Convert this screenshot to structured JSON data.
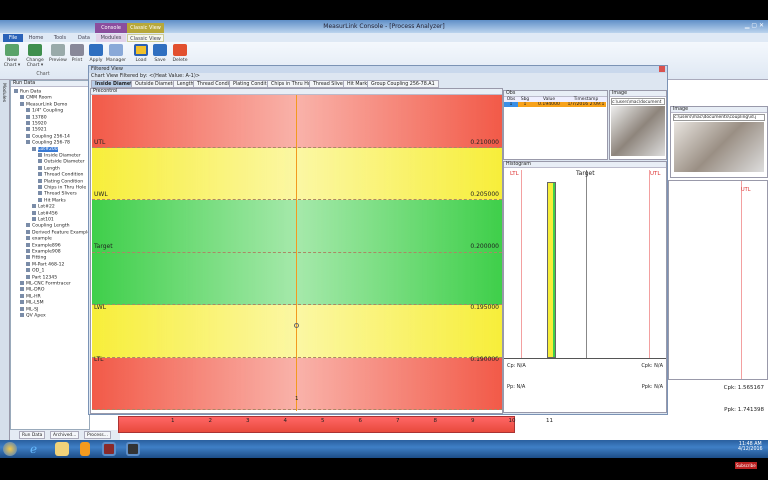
{
  "window": {
    "title": "MeasurLink Console - [Process Analyzer]"
  },
  "ribbon": {
    "context_tabs": [
      {
        "label": "Console",
        "color": "#8b4e9e"
      },
      {
        "label": "Classic View",
        "color": "#b7a83a"
      }
    ],
    "tabs": [
      "File",
      "Home",
      "Tools",
      "Data",
      "Modules",
      "Classic View"
    ],
    "active_tab": "Classic View",
    "buttons": [
      {
        "label": "New Chart ▾",
        "icon": "new-chart-icon"
      },
      {
        "label": "Change Chart ▾",
        "icon": "change-chart-icon"
      },
      {
        "label": "Preview",
        "icon": "preview-icon"
      },
      {
        "label": "Print",
        "icon": "print-icon"
      },
      {
        "label": "Apply",
        "icon": "apply-icon"
      },
      {
        "label": "Manager",
        "icon": "manager-icon"
      },
      {
        "label": "Load",
        "icon": "load-icon"
      },
      {
        "label": "Save",
        "icon": "save-icon"
      },
      {
        "label": "Delete",
        "icon": "delete-icon"
      }
    ],
    "group_label": "Chart"
  },
  "sidebar": {
    "strip_label": "Modules",
    "header": "Run Data",
    "tree": [
      {
        "label": "Run Data",
        "level": 0
      },
      {
        "label": "CMM Room",
        "level": 1
      },
      {
        "label": "MeasurLink Demo",
        "level": 1
      },
      {
        "label": "1/4\" Coupling",
        "level": 2
      },
      {
        "label": "13780",
        "level": 2
      },
      {
        "label": "15920",
        "level": 2
      },
      {
        "label": "15921",
        "level": 2
      },
      {
        "label": "Coupling 256-14",
        "level": 2
      },
      {
        "label": "Coupling 256-78",
        "level": 2
      },
      {
        "label": "Lot#200",
        "level": 3,
        "selected": true
      },
      {
        "label": "Inside Diameter",
        "level": 4
      },
      {
        "label": "Outside Diameter",
        "level": 4
      },
      {
        "label": "Length",
        "level": 4
      },
      {
        "label": "Thread Condition",
        "level": 4
      },
      {
        "label": "Plating Condition",
        "level": 4
      },
      {
        "label": "Chips in Thru Hole",
        "level": 4
      },
      {
        "label": "Thread Slivers",
        "level": 4
      },
      {
        "label": "Hit Marks",
        "level": 4
      },
      {
        "label": "Lot#22",
        "level": 3
      },
      {
        "label": "Lot#456",
        "level": 3
      },
      {
        "label": "Lot101",
        "level": 3
      },
      {
        "label": "Coupling Length",
        "level": 2
      },
      {
        "label": "Derived Feature Example",
        "level": 2
      },
      {
        "label": "example",
        "level": 2
      },
      {
        "label": "Example896",
        "level": 2
      },
      {
        "label": "Example908",
        "level": 2
      },
      {
        "label": "Fitting",
        "level": 2
      },
      {
        "label": "M-Part 468-12",
        "level": 2
      },
      {
        "label": "OD_1",
        "level": 2
      },
      {
        "label": "Part 12345",
        "level": 2
      },
      {
        "label": "ML-CNC Formtracer",
        "level": 1
      },
      {
        "label": "ML-DRO",
        "level": 1
      },
      {
        "label": "ML-HR",
        "level": 1
      },
      {
        "label": "ML-LSM",
        "level": 1
      },
      {
        "label": "ML-SJ",
        "level": 1
      },
      {
        "label": "QV Apex",
        "level": 1
      }
    ],
    "bottom_tabs": [
      "Run Data",
      "Archived...",
      "Process..."
    ]
  },
  "filtered_view": {
    "title": "Filtered View",
    "filter_text": "Chart View Filtered by: <(Heat Value: A-1)>",
    "tabs": [
      "Inside Diameter",
      "Outside Diameter",
      "Length",
      "Thread Condition",
      "Plating Condition",
      "Chips in Thru Hole",
      "Thread Slivers",
      "Hit Marks",
      "Group Coupling 256-78.A1"
    ],
    "active_tab": "Inside Diameter",
    "precontrol": {
      "title": "Precontrol",
      "limits": [
        {
          "label": "UTL",
          "value": "0.210000"
        },
        {
          "label": "UWL",
          "value": "0.205000"
        },
        {
          "label": "Target",
          "value": "0.200000"
        },
        {
          "label": "LWL",
          "value": "0.195000"
        },
        {
          "label": "LTL",
          "value": "0.190000"
        }
      ],
      "zone_colors": {
        "red": "#f25a48",
        "yellow": "#f7ee3a",
        "green": "#3fcf4a"
      },
      "points": [
        {
          "obs": 1,
          "value": 0.194
        }
      ],
      "x_label": "1"
    },
    "obs": {
      "title": "Obs",
      "columns": [
        "Obs",
        "Sbg",
        "Value",
        "Timestamp"
      ],
      "rows": [
        [
          "1",
          "1",
          "0.194000",
          "1/7/2016 2:09:1"
        ]
      ]
    },
    "image": {
      "title": "Image",
      "path": "c:\\users\\mac\\document"
    },
    "histogram": {
      "title": "Histogram",
      "ltl": "LTL",
      "utl": "UTL",
      "target": "Target",
      "cp": "Cp: N/A",
      "cpk": "Cpk: N/A",
      "pp": "Pp: N/A",
      "ppk": "Ppk: N/A"
    }
  },
  "background_window": {
    "image_title": "Image",
    "image_path": "c:\\users\\mac\\documents\\coupling\\id.j",
    "utl": "UTL",
    "cpk": "Cpk: 1.565167",
    "ppk": "Ppk: 1.741398",
    "axis_ticks": [
      "1",
      "2",
      "3",
      "4",
      "5",
      "6",
      "7",
      "8",
      "9",
      "10",
      "11"
    ]
  },
  "taskbar": {
    "time": "11:48 AM",
    "date": "4/12/2016"
  },
  "overlay": {
    "subscribe": "Subscribe"
  }
}
